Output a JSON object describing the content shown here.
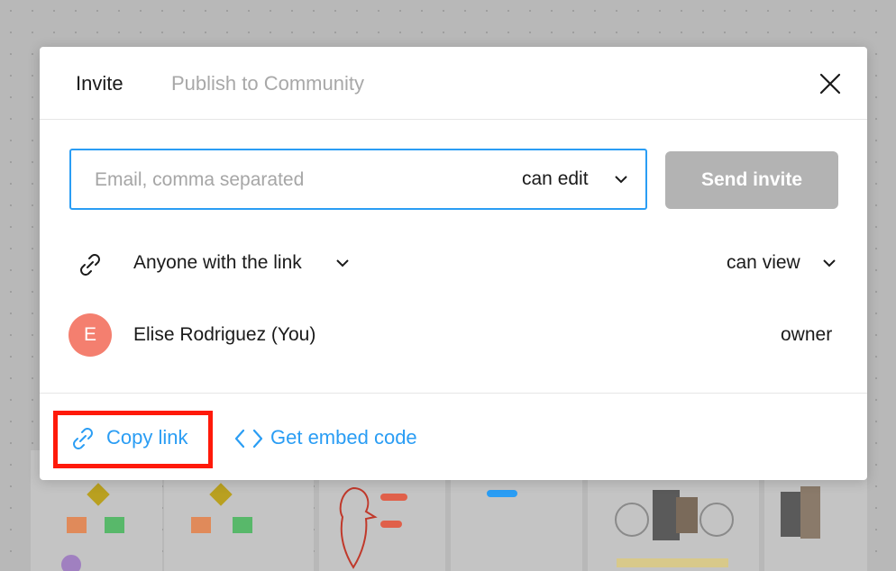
{
  "dialog": {
    "tabs": [
      {
        "label": "Invite"
      },
      {
        "label": "Publish to Community"
      }
    ],
    "invite": {
      "email_placeholder": "Email, comma separated",
      "email_value": "",
      "permission": "can edit",
      "send_label": "Send invite"
    },
    "link_access": {
      "scope": "Anyone with the link",
      "role": "can view"
    },
    "members": [
      {
        "initial": "E",
        "name": "Elise Rodriguez (You)",
        "role": "owner",
        "avatar_color": "#f47f6f"
      }
    ],
    "footer": {
      "copy_link_label": "Copy link",
      "embed_label": "Get embed code"
    }
  },
  "colors": {
    "accent": "#2a9df4",
    "disabled_button": "#b3b3b3",
    "highlight": "#ff1a0a"
  }
}
